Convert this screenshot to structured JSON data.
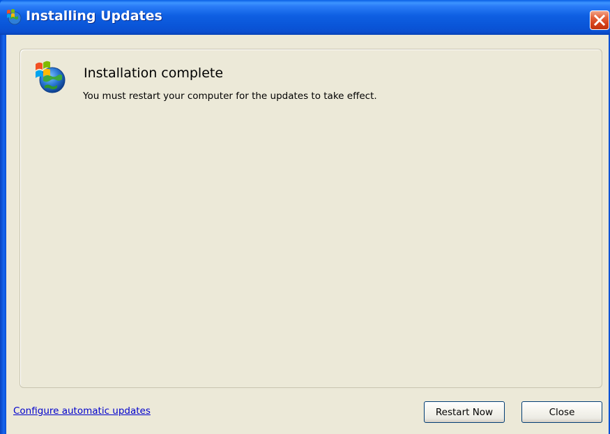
{
  "window": {
    "title": "Installing Updates",
    "icons": {
      "title": "windows-update-icon",
      "close": "close-icon"
    }
  },
  "content": {
    "icon": "windows-update-globe-icon",
    "heading": "Installation complete",
    "message": "You must restart your computer for the updates to take effect."
  },
  "footer": {
    "link_label": "Configure automatic updates",
    "restart_label": "Restart Now",
    "close_label": "Close"
  },
  "colors": {
    "titlebar": "#0a55d8",
    "client_background": "#ece9d8",
    "link": "#0000cc",
    "close_button": "#d5401a"
  }
}
